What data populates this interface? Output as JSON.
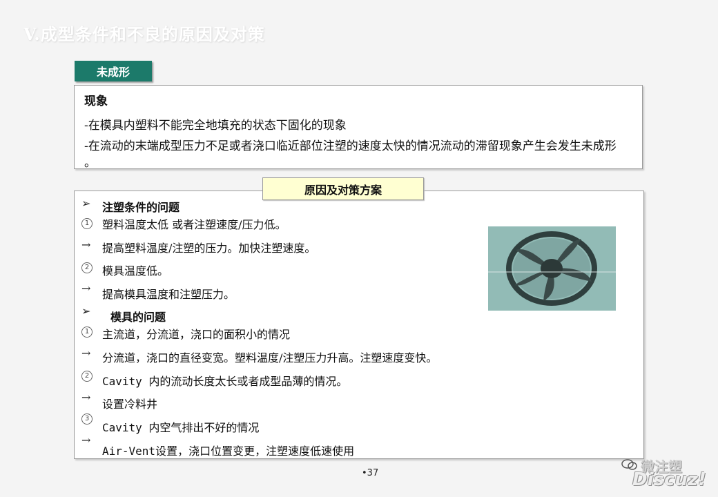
{
  "title": "V.成型条件和不良的原因及对策",
  "tab": "未成形",
  "phenomenon": {
    "heading": "现象",
    "line1": "-在模具内塑料不能完全地填充的状态下固化的现象",
    "line2": "-在流动的末端成型压力不足或者浇口临近部位注塑的速度太快的情况流动的滞留现象产生会发生未成形  。"
  },
  "banner": "原因及对策方案",
  "items": {
    "h1": "注塑条件的问题",
    "r1": "塑料温度太低 或者注塑速度/压力低。",
    "r2": "提高塑料温度/注塑的压力。加快注塑速度。",
    "r3": "模具温度低。",
    "r4": "提高模具温度和注塑压力。",
    "h2": "模具的问题",
    "r5": "主流道，分流道，浇口的面积小的情况",
    "r6": "分流道，浇口的直径变宽。塑料温度/注塑压力升高。注塑速度变快。",
    "r7": "Cavity 内的流动长度太长或者成型品薄的情况。",
    "r8": "设置冷料井",
    "r9": "Cavity 内空气排出不好的情况",
    "r10": "Air-Vent设置，浇口位置变更，注塑速度低速使用"
  },
  "symbols": {
    "pointer": "➢",
    "arrow": "→",
    "c1": "1",
    "c2": "2",
    "c3": "3"
  },
  "page_number": "•37",
  "watermark": {
    "line1": "微注塑",
    "line2": "Discuz!"
  },
  "image": {
    "subject": "fan-image",
    "bg_color": "#8fb9b4"
  }
}
